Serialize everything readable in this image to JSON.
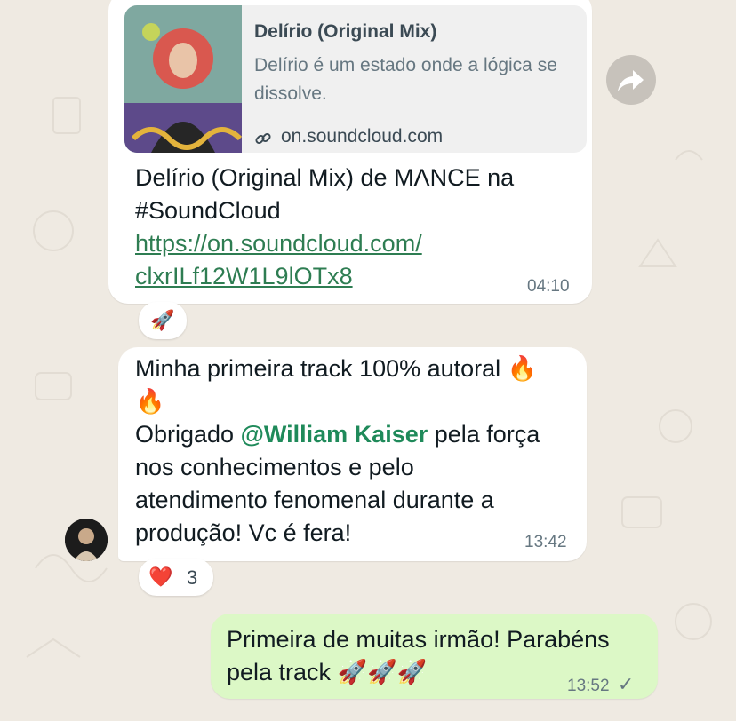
{
  "messages": {
    "m1": {
      "preview_title": "Delírio (Original Mix)",
      "preview_desc": "Delírio é um estado onde a lógica se dissolve.",
      "preview_domain": "on.soundcloud.com",
      "text_line1": "Delírio (Original Mix) de MΛNCE na",
      "text_line2": "#SoundCloud",
      "link_line1": "https://on.soundcloud.com/",
      "link_line2": "clxrILf12W1L9lOTx8",
      "time": "04:10",
      "reaction_emoji": "🚀"
    },
    "m2": {
      "line1": "Minha primeira track 100% autoral 🔥",
      "line2": "🔥",
      "line3_pre": "Obrigado ",
      "mention": "@William Kaiser",
      "line3_post": " pela força",
      "line4": "nos conhecimentos e pelo",
      "line5": "atendimento fenomenal durante a",
      "line6": "produção! Vc é fera!",
      "time": "13:42",
      "reaction_emoji": "❤️",
      "reaction_count": "3"
    },
    "m3": {
      "line1": "Primeira de muitas irmão! Parabéns",
      "line2": "pela track 🚀🚀🚀",
      "time": "13:52",
      "status": "✓"
    }
  },
  "icons": {
    "forward": "forward-arrow-icon",
    "link": "link-icon",
    "check": "single-check-icon"
  },
  "colors": {
    "background": "#efeae2",
    "incoming": "#ffffff",
    "outgoing": "#dcf8c6",
    "link": "#2e7d52"
  }
}
